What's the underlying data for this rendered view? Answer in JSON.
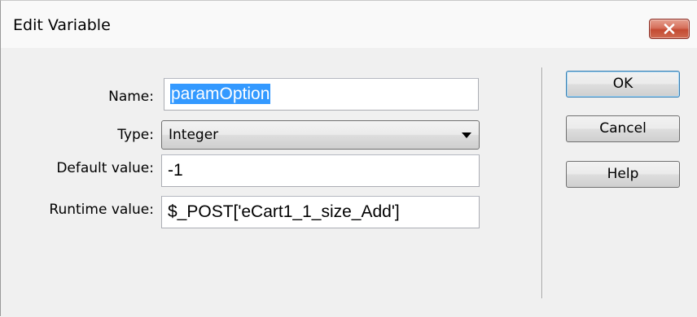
{
  "window": {
    "title": "Edit Variable",
    "close_icon": "close-x-icon"
  },
  "form": {
    "name": {
      "label": "Name:",
      "value": "paramOption"
    },
    "type": {
      "label": "Type:",
      "value": "Integer"
    },
    "default_value": {
      "label": "Default value:",
      "value": "-1"
    },
    "runtime_value": {
      "label": "Runtime value:",
      "value": "$_POST['eCart1_1_size_Add']"
    }
  },
  "buttons": {
    "ok": "OK",
    "cancel": "Cancel",
    "help": "Help"
  },
  "colors": {
    "selection": "#3399ff",
    "close_button": "#c44a32",
    "dialog_background": "#f0f0f0"
  }
}
